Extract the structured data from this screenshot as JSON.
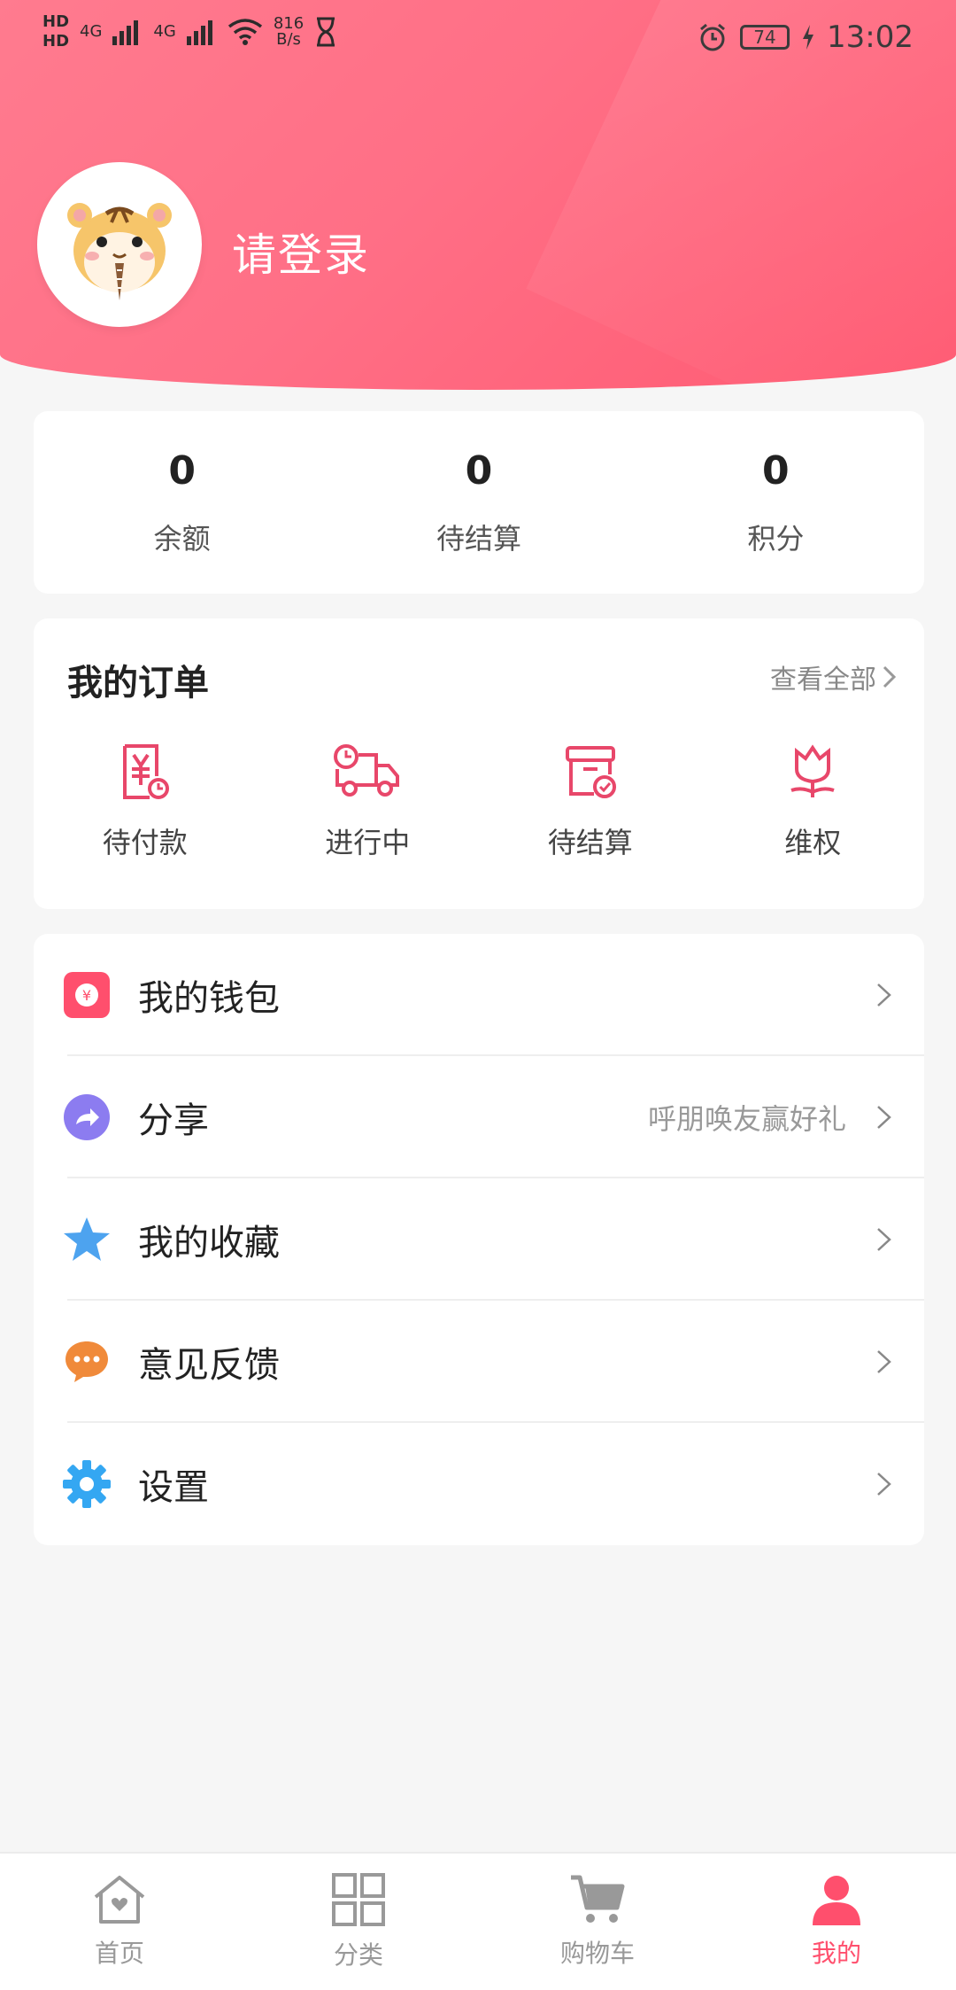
{
  "status_bar": {
    "left_net_1": "HD",
    "left_net_2": "HD",
    "gen_1": "4G",
    "gen_2": "4G",
    "speed_value": "816",
    "speed_unit": "B/s",
    "battery": "74",
    "time": "13:02"
  },
  "header": {
    "login_text": "请登录"
  },
  "stats": [
    {
      "value": "0",
      "label": "余额"
    },
    {
      "value": "0",
      "label": "待结算"
    },
    {
      "value": "0",
      "label": "积分"
    }
  ],
  "orders": {
    "title": "我的订单",
    "view_all": "查看全部",
    "items": [
      {
        "label": "待付款"
      },
      {
        "label": "进行中"
      },
      {
        "label": "待结算"
      },
      {
        "label": "维权"
      }
    ]
  },
  "menu": [
    {
      "label": "我的钱包",
      "sub": ""
    },
    {
      "label": "分享",
      "sub": "呼朋唤友赢好礼"
    },
    {
      "label": "我的收藏",
      "sub": ""
    },
    {
      "label": "意见反馈",
      "sub": ""
    },
    {
      "label": "设置",
      "sub": ""
    }
  ],
  "tabbar": [
    {
      "label": "首页"
    },
    {
      "label": "分类"
    },
    {
      "label": "购物车"
    },
    {
      "label": "我的"
    }
  ],
  "colors": {
    "accent": "#ff4f6d",
    "wallet_icon": "#ff4f6d",
    "share_icon": "#8c7cf0",
    "fav_icon": "#4da3ef",
    "feedback_icon": "#f08a3a",
    "settings_icon": "#34a7f2"
  }
}
